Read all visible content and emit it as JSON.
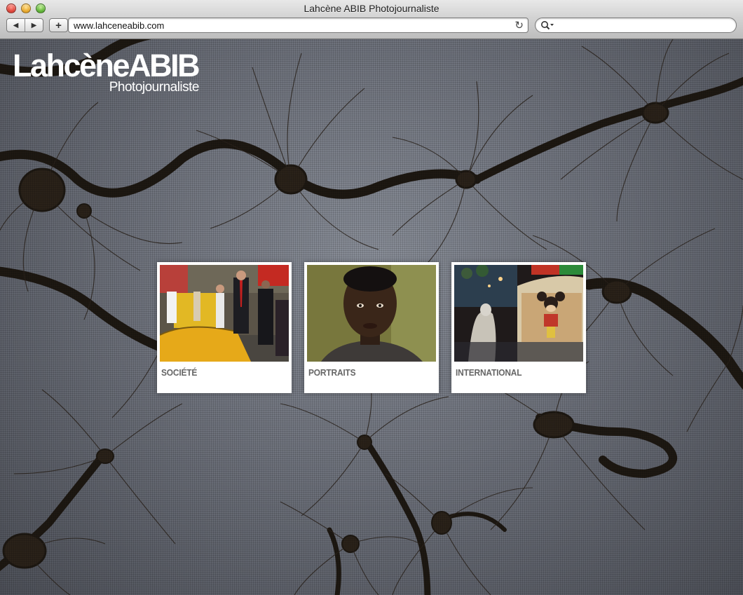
{
  "browser": {
    "window_title": "Lahcène ABIB Photojournaliste",
    "back_icon": "back-arrow-icon",
    "forward_icon": "forward-arrow-icon",
    "add_icon": "plus-icon",
    "add_label": "+",
    "url": "www.lahceneabib.com",
    "reload_icon": "reload-icon",
    "reload_glyph": "↻",
    "search_icon": "search-icon",
    "search_value": "",
    "back_glyph": "◀",
    "forward_glyph": "▶"
  },
  "site": {
    "logo_name": "LahcèneABIB",
    "logo_tagline": "Photojournaliste",
    "categories": [
      {
        "label": "SOCIÉTÉ"
      },
      {
        "label": "PORTRAITS"
      },
      {
        "label": "INTERNATIONAL"
      }
    ]
  }
}
